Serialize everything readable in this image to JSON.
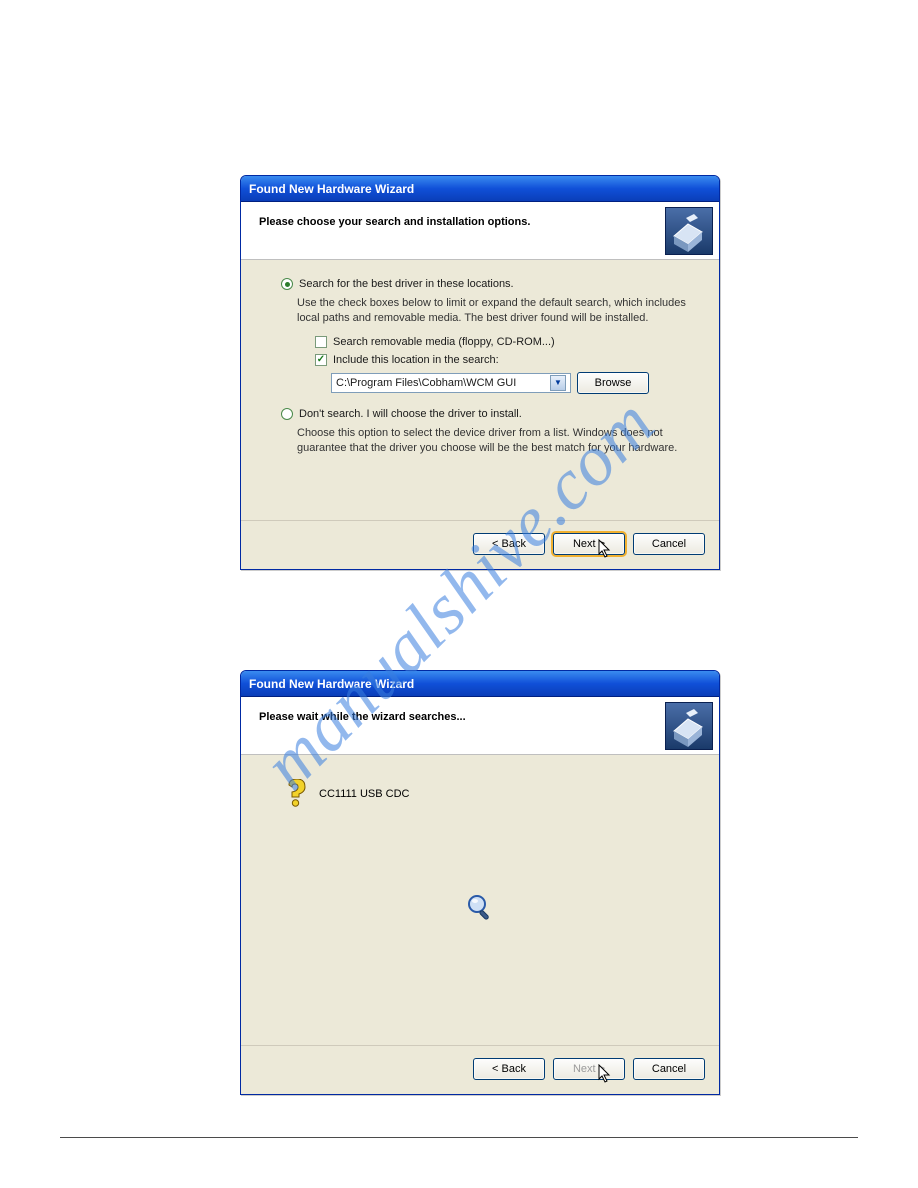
{
  "watermark": "manualshive.com",
  "dialog1": {
    "title": "Found New Hardware Wizard",
    "headline": "Please choose your search and installation options.",
    "opt_search": "Search for the best driver in these locations.",
    "opt_search_desc": "Use the check boxes below to limit or expand the default search, which includes local paths and removable media. The best driver found will be installed.",
    "chk_removable": "Search removable media (floppy, CD-ROM...)",
    "chk_include": "Include this location in the search:",
    "path_value": "C:\\Program Files\\Cobham\\WCM GUI",
    "browse": "Browse",
    "opt_noauto": "Don't search. I will choose the driver to install.",
    "opt_noauto_desc": "Choose this option to select the device driver from a list.  Windows does not guarantee that the driver you choose will be the best match for your hardware.",
    "back": "< Back",
    "next": "Next >",
    "cancel": "Cancel"
  },
  "dialog2": {
    "title": "Found New Hardware Wizard",
    "headline": "Please wait while the wizard searches...",
    "device": "CC1111 USB CDC",
    "back": "< Back",
    "next": "Next >",
    "cancel": "Cancel"
  }
}
